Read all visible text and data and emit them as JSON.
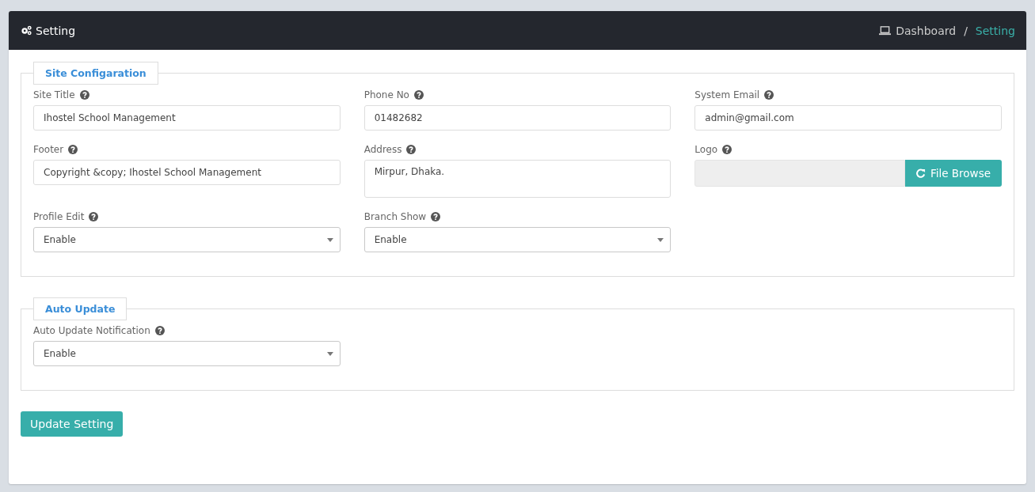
{
  "header": {
    "title": "Setting",
    "separator": "/",
    "breadcrumb": [
      {
        "label": "Dashboard",
        "selected": false
      },
      {
        "label": "Setting",
        "selected": true
      }
    ]
  },
  "sections": [
    {
      "title": "Site Configaration",
      "fields": [
        {
          "kind": "text",
          "label": "Site Title",
          "value": "Ihostel School Management"
        },
        {
          "kind": "text",
          "label": "Phone No",
          "value": "01482682"
        },
        {
          "kind": "text",
          "label": "System Email",
          "value": "admin@gmail.com"
        },
        {
          "kind": "text",
          "label": "Footer",
          "value": "Copyright &copy; Ihostel School Management"
        },
        {
          "kind": "textarea",
          "label": "Address",
          "value": "Mirpur, Dhaka."
        },
        {
          "kind": "file",
          "label": "Logo",
          "button": "File Browse"
        },
        {
          "kind": "select",
          "label": "Profile Edit",
          "value": "Enable"
        },
        {
          "kind": "select",
          "label": "Branch Show",
          "value": "Enable"
        }
      ]
    },
    {
      "title": "Auto Update",
      "fields": [
        {
          "kind": "select",
          "label": "Auto Update Notification",
          "value": "Enable"
        }
      ]
    }
  ],
  "submit": "Update Setting"
}
